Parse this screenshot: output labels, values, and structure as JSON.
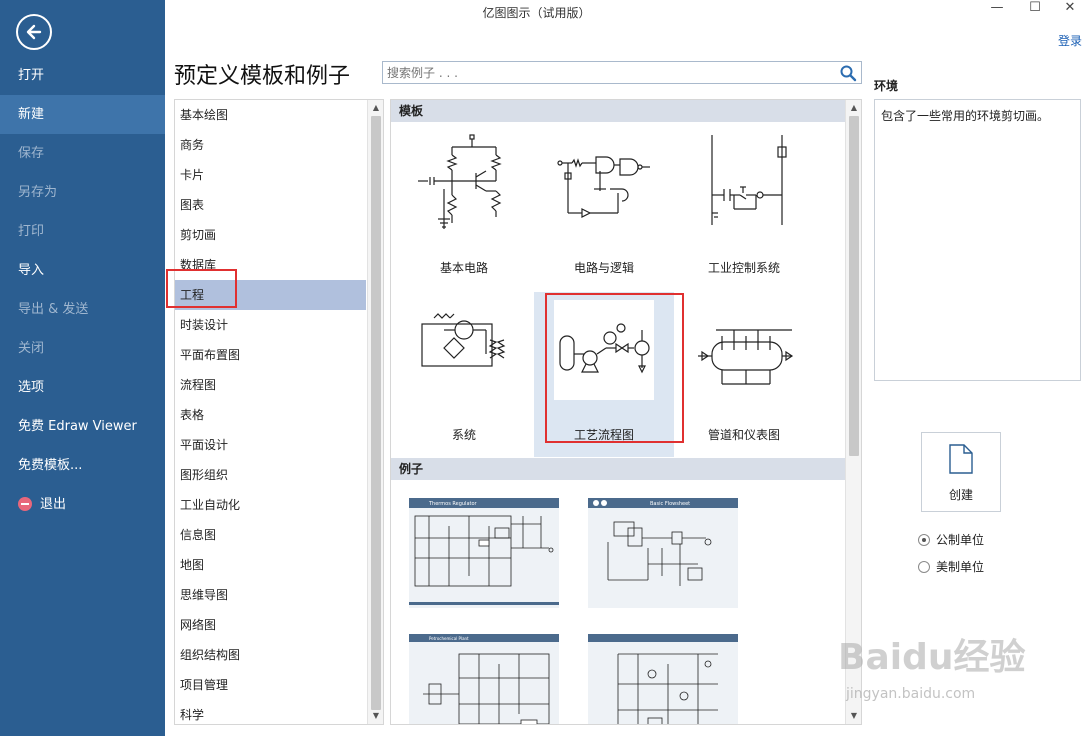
{
  "window": {
    "title": "亿图图示（试用版）",
    "minimize_glyph": "—",
    "maximize_glyph": "☐",
    "close_glyph": "✕",
    "login_label": "登录"
  },
  "sidebar": {
    "back_icon": "arrow-left-icon",
    "items": [
      {
        "label": "打开",
        "enabled": true
      },
      {
        "label": "新建",
        "enabled": true,
        "active": true
      },
      {
        "label": "保存",
        "enabled": false
      },
      {
        "label": "另存为",
        "enabled": false
      },
      {
        "label": "打印",
        "enabled": false
      },
      {
        "label": "导入",
        "enabled": true
      },
      {
        "label": "导出 & 发送",
        "enabled": false
      },
      {
        "label": "关闭",
        "enabled": false
      },
      {
        "label": "选项",
        "enabled": true
      },
      {
        "label": "免费 Edraw Viewer",
        "enabled": true
      },
      {
        "label": "免费模板...",
        "enabled": true
      },
      {
        "label": "退出",
        "enabled": true,
        "icon": "exit-icon"
      }
    ]
  },
  "header": {
    "title": "预定义模板和例子",
    "search_placeholder": "搜索例子 . . ."
  },
  "categories": {
    "items": [
      "基本绘图",
      "商务",
      "卡片",
      "图表",
      "剪切画",
      "数据库",
      "工程",
      "时装设计",
      "平面布置图",
      "流程图",
      "表格",
      "平面设计",
      "图形组织",
      "工业自动化",
      "信息图",
      "地图",
      "思维导图",
      "网络图",
      "组织结构图",
      "项目管理",
      "科学"
    ],
    "selected": "工程"
  },
  "templates": {
    "section_label": "模板",
    "items": [
      {
        "label": "基本电路"
      },
      {
        "label": "电路与逻辑"
      },
      {
        "label": "工业控制系统"
      },
      {
        "label": "系统"
      },
      {
        "label": "工艺流程图",
        "selected": true
      },
      {
        "label": "管道和仪表图"
      }
    ]
  },
  "examples": {
    "section_label": "例子",
    "items": [
      {
        "title": "Thermos Regulator"
      },
      {
        "title": "Basic Flowsheet"
      },
      {
        "title": "Petrochemical Plant"
      },
      {
        "title": ""
      }
    ]
  },
  "detail": {
    "title": "环境",
    "description": "包含了一些常用的环境剪切画。",
    "create_label": "创建",
    "units": [
      {
        "label": "公制单位",
        "checked": true
      },
      {
        "label": "美制单位",
        "checked": false
      }
    ]
  },
  "watermark": {
    "logo_text": "Baidu经验",
    "url_text": "jingyan.baidu.com"
  },
  "colors": {
    "sidebar_bg": "#2b5e91",
    "sidebar_active": "#3e74aa",
    "selected_category": "#b0c0dd",
    "selected_tile": "#dce6f2",
    "highlight": "#e03030",
    "link": "#1a5fb4"
  }
}
